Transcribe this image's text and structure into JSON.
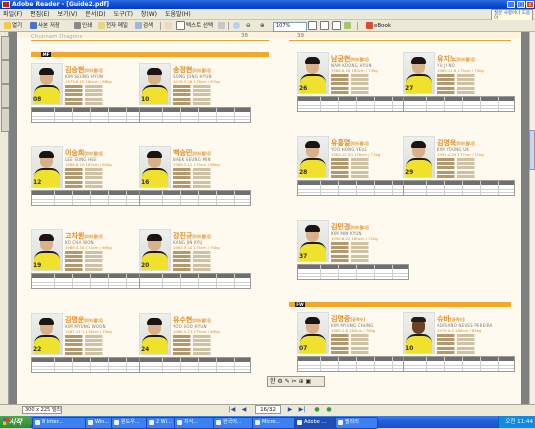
{
  "window": {
    "title": "Adobe Reader - [Guide2.pdf]",
    "minimize": "_",
    "maximize": "□",
    "close": "x"
  },
  "menubar": {
    "items": [
      "파일(F)",
      "편집(E)",
      "보기(V)",
      "문서(D)",
      "도구(T)",
      "창(W)",
      "도움말(H)"
    ]
  },
  "help_box": {
    "line1": "질문 사항이나 도움이",
    "line2": "필요하면 입력하십시오"
  },
  "toolbar": {
    "save_label": "열기",
    "copy_label": "사본 저장",
    "print_label": "인쇄",
    "email_label": "전자 메일",
    "search_label": "검색",
    "select_label": "텍스트 선택",
    "zoom_value": "107%",
    "ebook_label": "eBook"
  },
  "document": {
    "left_page": {
      "header": "Chunnam Dragons",
      "page_number": "38",
      "section": "MF",
      "players": [
        {
          "name_kr": "김승현",
          "pos": "[미드필더]",
          "name_en": "KIM SEUNG HYUN",
          "stats": "1979.8.15  180cm / 68kg",
          "number": "08"
        },
        {
          "name_kr": "송정현",
          "pos": "[미드필더]",
          "name_en": "SONG JUNG HYUN",
          "stats": "1976.5.28  178cm / 67kg",
          "number": "10"
        },
        {
          "name_kr": "이승희",
          "pos": "[미드필더]",
          "name_en": "LEE SUNG HEE",
          "stats": "1988.6.10  183cm / 80kg",
          "number": "12"
        },
        {
          "name_kr": "백승민",
          "pos": "[미드필더]",
          "name_en": "BAEK SEUNG MIN",
          "stats": "1986.3.12  175cm / 68kg",
          "number": "16"
        },
        {
          "name_kr": "고차원",
          "pos": "[미드필더]",
          "name_en": "KO CHA WON",
          "stats": "1986.4.30  174cm / 69kg",
          "number": "19"
        },
        {
          "name_kr": "강진규",
          "pos": "[미드필더]",
          "name_en": "KANG JIN KYU",
          "stats": "1983.9.10  175cm / 70kg",
          "number": "20"
        },
        {
          "name_kr": "김명운",
          "pos": "[미드필더]",
          "name_en": "KIM MYUNG WOON",
          "stats": "1987.11.1  176cm / 70kg",
          "number": "22"
        },
        {
          "name_kr": "유수현",
          "pos": "[미드필더]",
          "name_en": "YOO SOO HYUN",
          "stats": "1986.5.13  175cm / 69kg",
          "number": "24"
        }
      ]
    },
    "right_page": {
      "page_number": "39",
      "players_mf": [
        {
          "name_kr": "남궁현",
          "pos": "[미드필더]",
          "name_en": "NAM KOONG HYUN",
          "stats": "1988.6.28  180cm / 73kg",
          "number": "26"
        },
        {
          "name_kr": "유지노",
          "pos": "[미드필더]",
          "name_en": "YU JI NO",
          "stats": "1989.11.6  175cm / 70kg",
          "number": "27"
        },
        {
          "name_kr": "유홍열",
          "pos": "[미드필더]",
          "name_en": "YOO HONG YEUL",
          "stats": "1983.12.30  176cm / 71kg",
          "number": "28"
        },
        {
          "name_kr": "김영욱",
          "pos": "[미드필더]",
          "name_en": "KIM YOUNG UK",
          "stats": "1991.4.29  177cm / 71kg",
          "number": "29"
        },
        {
          "name_kr": "김민경",
          "pos": "[미드필더]",
          "name_en": "KIM MIN KYUN",
          "stats": "1990.6.22  180cm / 72kg",
          "number": "37"
        }
      ],
      "section_fw": "FW",
      "players_fw": [
        {
          "name_kr": "김명중",
          "pos": "[공격수]",
          "name_en": "KIM MYUNG CHUNG",
          "stats": "1985.2.8  183cm / 78kg",
          "number": "07"
        },
        {
          "name_kr": "슈바",
          "pos": "[공격수]",
          "name_en": "ADRIANO NEVES PEREIRA",
          "stats": "1979.5.1  186cm / 85kg",
          "number": "10"
        }
      ]
    }
  },
  "floating_toolbar": {
    "label": "한 ⚙ ✎ ✂ ⊕ ▣"
  },
  "statusbar": {
    "page_size": "300 x 225 밀리",
    "page_indicator": "16/32",
    "first": "|◀",
    "prev": "◀",
    "next": "▶",
    "last": "▶|",
    "back": "●",
    "forward": "●"
  },
  "taskbar": {
    "start": "시작",
    "tasks": [
      "8 Inter...",
      "Win...",
      "윈도우...",
      "2 Wi...",
      "지식...",
      "한국어...",
      "Micro...",
      "Adobe ...",
      "필라리"
    ],
    "clock": "오전 11:44"
  }
}
